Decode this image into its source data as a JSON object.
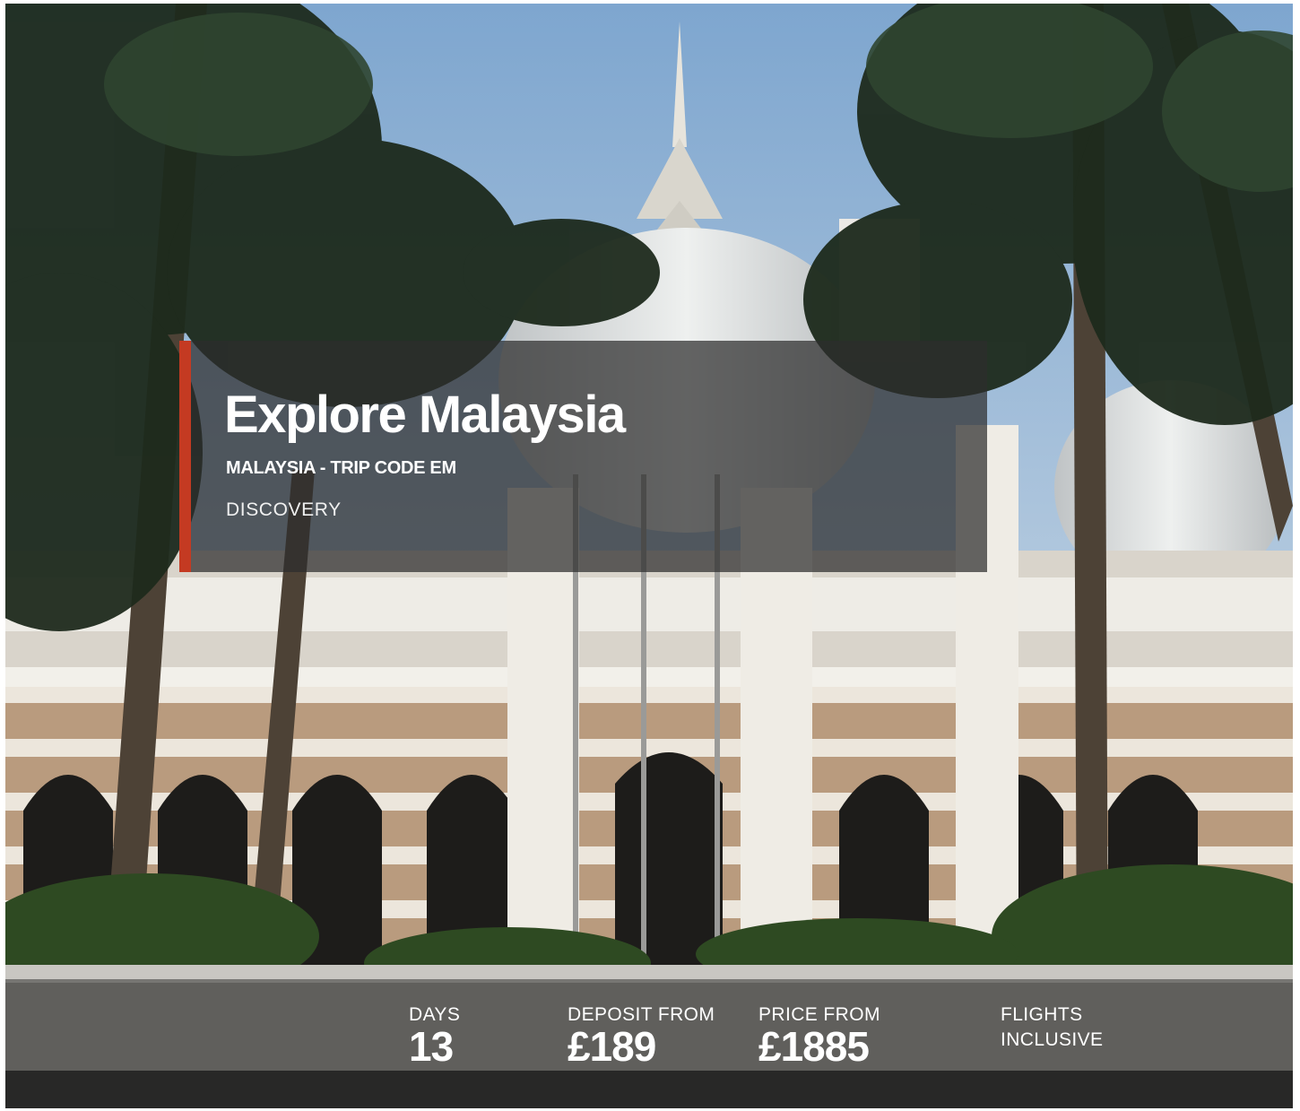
{
  "trip": {
    "title": "Explore Malaysia",
    "subtitle": "MALAYSIA - TRIP CODE EM",
    "style": "DISCOVERY"
  },
  "stats": {
    "days": {
      "label": "DAYS",
      "value": "13"
    },
    "deposit": {
      "label": "DEPOSIT FROM",
      "value": "£189"
    },
    "price": {
      "label": "PRICE FROM",
      "value": "£1885"
    },
    "flights": {
      "label": "FLIGHTS INCLUSIVE"
    }
  },
  "colors": {
    "accent": "#c43a22",
    "text": "#ffffff",
    "panel": "#2d2d2d"
  },
  "hero_image": {
    "icon": "mosque-photo"
  }
}
